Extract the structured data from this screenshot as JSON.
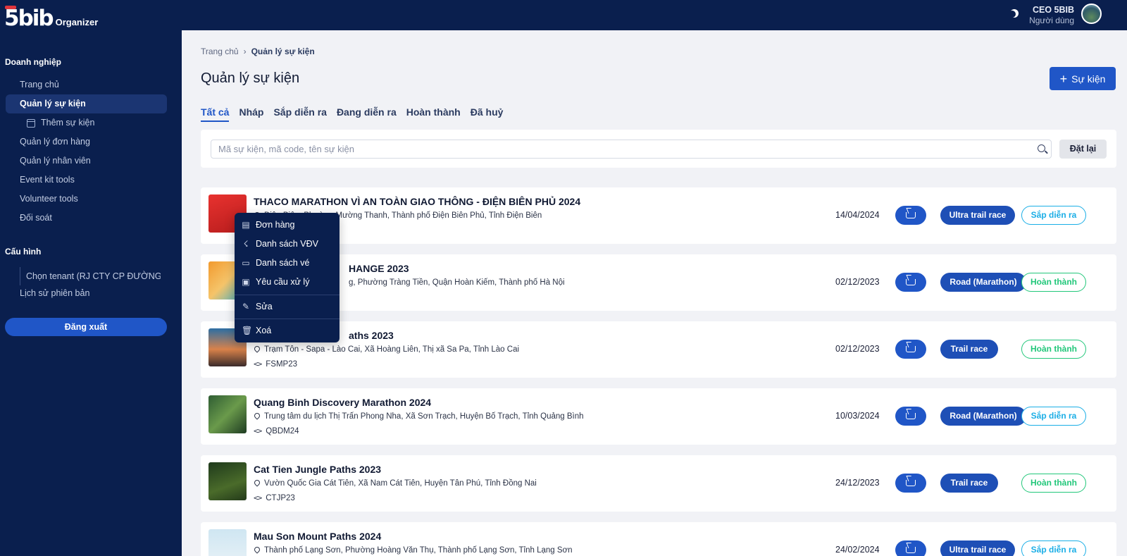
{
  "brand": {
    "logo": "5bib",
    "sub": "Organizer"
  },
  "sidebar": {
    "section_business": "Doanh nghiệp",
    "items": [
      {
        "label": "Trang chủ"
      },
      {
        "label": "Quản lý sự kiện"
      },
      {
        "label": "Thêm sự kiện"
      },
      {
        "label": "Quản lý đơn hàng"
      },
      {
        "label": "Quản lý nhân viên"
      },
      {
        "label": "Event kit tools"
      },
      {
        "label": "Volunteer tools"
      },
      {
        "label": "Đối soát"
      }
    ],
    "section_config": "Cấu hình",
    "tenant": "Chọn tenant (RJ CTY CP ĐƯỜNG...",
    "history": "Lịch sử phiên bản",
    "logout": "Đăng xuất"
  },
  "topbar": {
    "user_name": "CEO 5BIB",
    "user_role": "Người dùng"
  },
  "breadcrumb": {
    "home": "Trang chủ",
    "current": "Quản lý sự kiện"
  },
  "page": {
    "title": "Quản lý sự kiện",
    "add_button": "Sự kiện"
  },
  "tabs": [
    {
      "label": "Tất cả"
    },
    {
      "label": "Nháp"
    },
    {
      "label": "Sắp diễn ra"
    },
    {
      "label": "Đang diễn ra"
    },
    {
      "label": "Hoàn thành"
    },
    {
      "label": "Đã huỷ"
    }
  ],
  "search": {
    "placeholder": "Mã sự kiện, mã code, tên sự kiện",
    "reset": "Đặt lại"
  },
  "events": [
    {
      "title": "THACO MARATHON VÌ AN TOÀN GIAO THÔNG - ĐIỆN BIÊN PHỦ 2024",
      "location": "Điện Biên, Phường Mường Thanh, Thành phố Điện Biên Phủ, Tỉnh Điện Biên",
      "code": "",
      "date": "14/04/2024",
      "type": "Ultra trail race",
      "status": "Sắp diễn ra"
    },
    {
      "title": "HANGE 2023",
      "location": "g, Phường Tràng Tiền, Quận Hoàn Kiếm, Thành phố Hà Nội",
      "code": "",
      "date": "02/12/2023",
      "type": "Road (Marathon)",
      "status": "Hoàn thành"
    },
    {
      "title": "aths 2023",
      "location": "Trạm Tôn - Sapa - Lào Cai, Xã Hoàng Liên, Thị xã Sa Pa, Tỉnh Lào Cai",
      "code": "FSMP23",
      "date": "02/12/2023",
      "type": "Trail race",
      "status": "Hoàn thành"
    },
    {
      "title": "Quang Binh Discovery Marathon 2024",
      "location": "Trung tâm du lịch Thị Trấn Phong Nha, Xã Sơn Trạch, Huyện Bố Trạch, Tỉnh Quảng Bình",
      "code": "QBDM24",
      "date": "10/03/2024",
      "type": "Road (Marathon)",
      "status": "Sắp diễn ra"
    },
    {
      "title": "Cat Tien Jungle Paths 2023",
      "location": "Vườn Quốc Gia Cát Tiên, Xã Nam Cát Tiên, Huyện Tân Phú, Tỉnh Đồng Nai",
      "code": "CTJP23",
      "date": "24/12/2023",
      "type": "Trail race",
      "status": "Hoàn thành"
    },
    {
      "title": "Mau Son Mount Paths 2024",
      "location": "Thành phố Lạng Sơn, Phường Hoàng Văn Thụ, Thành phố Lạng Sơn, Tỉnh Lạng Sơn",
      "code": "",
      "date": "24/02/2024",
      "type": "Ultra trail race",
      "status": "Sắp diễn ra"
    }
  ],
  "context_menu": [
    {
      "label": "Đơn hàng",
      "icon": "clipboard-icon"
    },
    {
      "label": "Danh sách VĐV",
      "icon": "runner-icon"
    },
    {
      "label": "Danh sách vé",
      "icon": "ticket-icon"
    },
    {
      "label": "Yêu cầu xử lý",
      "icon": "request-icon"
    },
    {
      "label": "Sửa",
      "icon": "edit-icon"
    },
    {
      "label": "Xoá",
      "icon": "trash-icon"
    }
  ],
  "colors": {
    "sidebar_bg": "#0a1f4e",
    "primary": "#2056c7",
    "upcoming": "#1aaee6",
    "done": "#22c77a"
  }
}
